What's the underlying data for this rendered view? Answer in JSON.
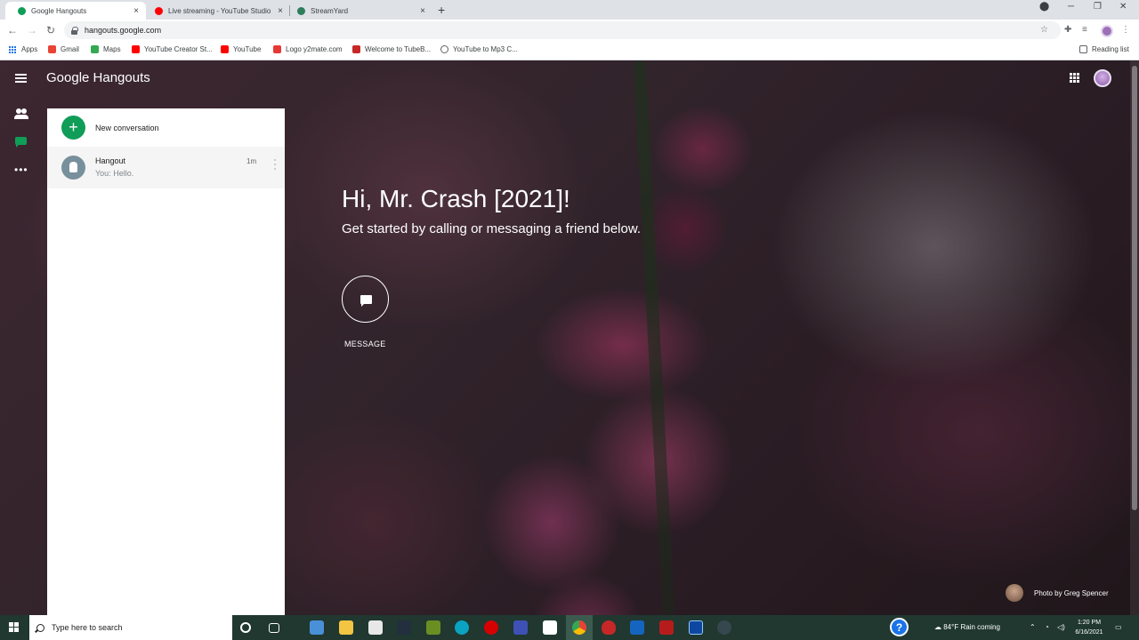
{
  "browser": {
    "tabs": [
      {
        "label": "Google Hangouts",
        "favicon_color": "#0f9d58",
        "active": true
      },
      {
        "label": "Live streaming - YouTube Studio",
        "favicon_color": "#ff0000",
        "active": false
      },
      {
        "label": "StreamYard",
        "favicon_color": "#2e7d5b",
        "active": false
      }
    ],
    "new_tab": "+",
    "close_glyph": "×",
    "url": "hangouts.google.com",
    "reading_list": "Reading list",
    "bookmarks": [
      {
        "label": "Apps",
        "icon": "apps-grid-icon"
      },
      {
        "label": "Gmail",
        "icon": "gmail-icon",
        "color": "#ea4335"
      },
      {
        "label": "Maps",
        "icon": "maps-icon",
        "color": "#34a853"
      },
      {
        "label": "YouTube Creator St...",
        "icon": "youtube-icon",
        "color": "#ff0000"
      },
      {
        "label": "YouTube",
        "icon": "youtube-icon",
        "color": "#ff0000"
      },
      {
        "label": "Logo y2mate.com",
        "icon": "y2mate-icon",
        "color": "#e53935"
      },
      {
        "label": "Welcome to TubeB...",
        "icon": "tubebuddy-icon",
        "color": "#c62828"
      },
      {
        "label": "YouTube to Mp3 C...",
        "icon": "cloud-icon",
        "color": "#5f6368"
      }
    ]
  },
  "hangouts": {
    "brand": "Google Hangouts",
    "new_conversation": "New conversation",
    "conversation": {
      "name": "Hangout",
      "snippet": "You: Hello.",
      "time": "1m"
    },
    "greeting": "Hi, Mr. Crash [2021]!",
    "subgreeting": "Get started by calling or messaging a friend below.",
    "message_label": "MESSAGE",
    "photo_credit": "Photo by Greg Spencer",
    "accent_color": "#0f9d58"
  },
  "taskbar": {
    "search_placeholder": "Type here to search",
    "weather": "84°F  Rain coming",
    "time": "1:20 PM",
    "date": "6/16/2021"
  }
}
